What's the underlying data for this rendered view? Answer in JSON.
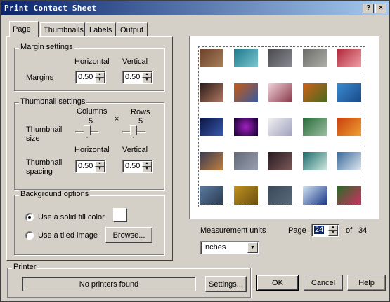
{
  "window": {
    "title": "Print Contact Sheet",
    "help_button": "?",
    "close_button": "×"
  },
  "tabs": [
    {
      "label": "Page",
      "active": true
    },
    {
      "label": "Thumbnails",
      "active": false
    },
    {
      "label": "Labels",
      "active": false
    },
    {
      "label": "Output",
      "active": false
    }
  ],
  "margin_settings": {
    "title": "Margin settings",
    "row_label": "Margins",
    "horizontal_label": "Horizontal",
    "vertical_label": "Vertical",
    "horizontal_value": "0.50",
    "vertical_value": "0.50"
  },
  "thumbnail_settings": {
    "title": "Thumbnail settings",
    "size_label": "Thumbnail size",
    "columns_label": "Columns",
    "rows_label": "Rows",
    "times_symbol": "×",
    "columns_value": "5",
    "rows_value": "5",
    "spacing_label": "Thumbnail spacing",
    "horizontal_label": "Horizontal",
    "vertical_label": "Vertical",
    "horizontal_value": "0.50",
    "vertical_value": "0.50"
  },
  "background_options": {
    "title": "Background options",
    "solid_fill_label": "Use a solid fill color",
    "tiled_image_label": "Use a tiled image",
    "browse_label": "Browse...",
    "selected": "solid_fill"
  },
  "measurement": {
    "label": "Measurement units",
    "value": "Inches"
  },
  "pagination": {
    "label": "Page",
    "current": "24",
    "of_label": "of",
    "total": "34"
  },
  "printer": {
    "title": "Printer",
    "status": "No printers found",
    "settings_label": "Settings..."
  },
  "buttons": {
    "ok": "OK",
    "cancel": "Cancel",
    "help": "Help"
  },
  "thumbnails": [
    "brown-sepia-scene",
    "waterfall-teal",
    "grey-rocks",
    "grey-animal",
    "red-flowers",
    "woman-portrait",
    "autumn-leaves",
    "child-portrait",
    "autumn-tree",
    "blue-bird",
    "night-blue-scene",
    "firework-circle",
    "sketch-drawing",
    "green-valley",
    "autumn-forest",
    "landscape-sunset",
    "grey-gravel",
    "dark-interior",
    "bird-flying",
    "mountain-lake",
    "sea-scene",
    "yellow-trees",
    "grey-texture",
    "boat-water",
    "pink-flowers"
  ],
  "colors": {
    "titlebar_start": "#0a246a",
    "titlebar_end": "#a6caf0",
    "face": "#d4d0c8",
    "page_highlight": "#0a246a"
  }
}
